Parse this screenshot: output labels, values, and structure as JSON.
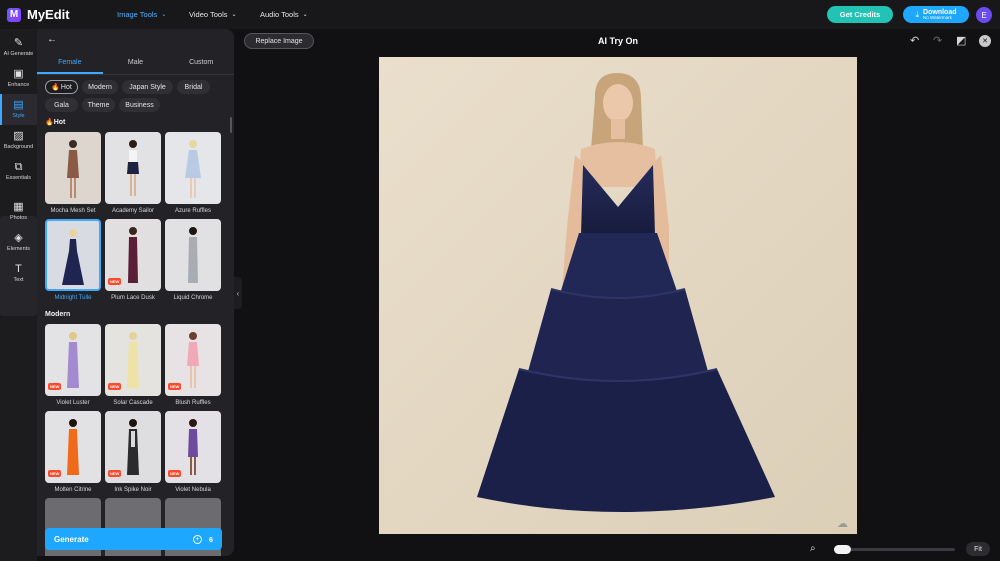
{
  "app": {
    "name": "MyEdit",
    "logo_letter": "M"
  },
  "nav": {
    "image_tools": "Image Tools",
    "video_tools": "Video Tools",
    "audio_tools": "Audio Tools"
  },
  "header": {
    "get_credits": "Get Credits",
    "download": "Download",
    "download_sub": "No Watermark",
    "avatar_letter": "E"
  },
  "rail": [
    {
      "label": "AI Generate",
      "icon": "wand-icon"
    },
    {
      "label": "Enhance",
      "icon": "image-enhance-icon"
    },
    {
      "label": "Style",
      "icon": "style-icon"
    },
    {
      "label": "Background",
      "icon": "background-icon"
    },
    {
      "label": "Essentials",
      "icon": "crop-icon"
    },
    {
      "label": "Photos",
      "icon": "photos-icon"
    },
    {
      "label": "Elements",
      "icon": "elements-icon"
    },
    {
      "label": "Text",
      "icon": "text-icon"
    }
  ],
  "panel": {
    "tabs": [
      "Female",
      "Male",
      "Custom"
    ],
    "active_tab": "Female",
    "chips": [
      "Hot",
      "Modern",
      "Japan Style",
      "Bridal",
      "Gala",
      "Theme",
      "Business"
    ],
    "active_chip": "Hot",
    "sections": {
      "hot": "Hot",
      "modern": "Modern"
    },
    "hot_items": [
      {
        "label": "Mocha Mesh Set",
        "new": false
      },
      {
        "label": "Academy Sailor",
        "new": false
      },
      {
        "label": "Azure Ruffles",
        "new": false
      },
      {
        "label": "Midnight Tulle",
        "new": false
      },
      {
        "label": "Plum Lace Dusk",
        "new": true
      },
      {
        "label": "Liquid Chrome",
        "new": false
      }
    ],
    "modern_items": [
      {
        "label": "Violet Luster",
        "new": true
      },
      {
        "label": "Solar Cascade",
        "new": true
      },
      {
        "label": "Blush Ruffles",
        "new": true
      },
      {
        "label": "Molten Citrine",
        "new": true
      },
      {
        "label": "Ink Spike Noir",
        "new": true
      },
      {
        "label": "Violet Nebula",
        "new": true
      }
    ],
    "new_badge": "NEW",
    "selected_item": "Midnight Tulle",
    "generate": {
      "label": "Generate",
      "credits": "6"
    }
  },
  "canvas": {
    "replace_image": "Replace Image",
    "title": "AI Try On",
    "fit": "Fit"
  },
  "colors": {
    "accent": "#1ea7ff",
    "credits": "#22c2b4",
    "dress": "#1f2450",
    "backdrop": "#e6dac6"
  }
}
